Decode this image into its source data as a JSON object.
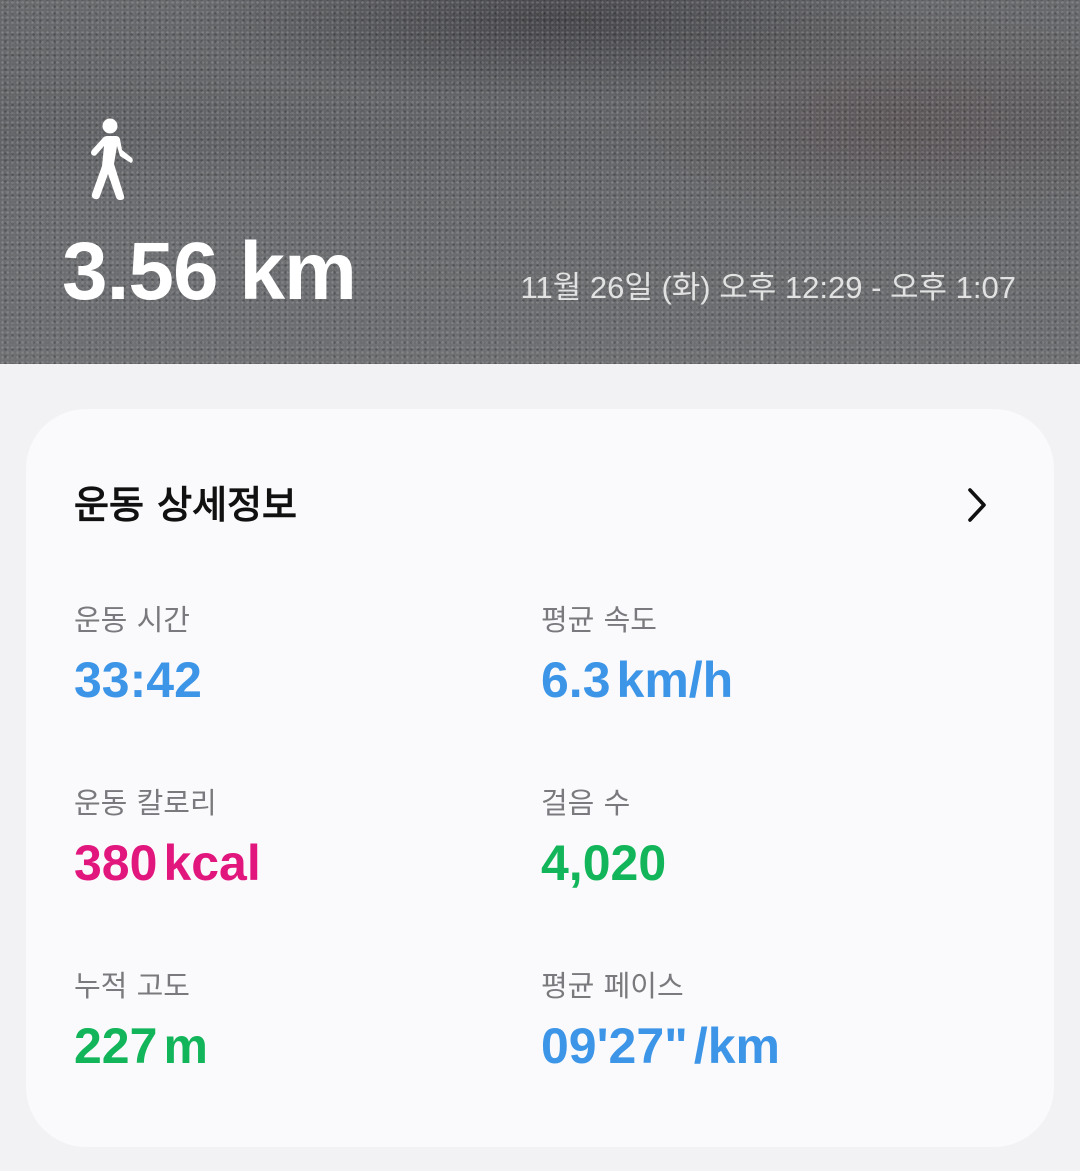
{
  "hero": {
    "activity_icon": "walking-person-icon",
    "distance": "3.56 km",
    "time_range": "11월 26일 (화) 오후 12:29 - 오후 1:07"
  },
  "details": {
    "title": "운동 상세정보",
    "chevron_icon": "chevron-right-icon",
    "stats": {
      "duration": {
        "label": "운동 시간",
        "value": "33:42",
        "color": "#3d95e8"
      },
      "avg_speed": {
        "label": "평균 속도",
        "value": "6.3",
        "unit": "km/h",
        "color": "#3d95e8"
      },
      "calories": {
        "label": "운동 칼로리",
        "value": "380",
        "unit": "kcal",
        "color": "#e2177e"
      },
      "steps": {
        "label": "걸음 수",
        "value": "4,020",
        "color": "#13b55a"
      },
      "elevation": {
        "label": "누적 고도",
        "value": "227",
        "unit": "m",
        "color": "#13b55a"
      },
      "avg_pace": {
        "label": "평균 페이스",
        "value": "09'27\"",
        "unit": "/km",
        "color": "#3d95e8"
      }
    }
  }
}
